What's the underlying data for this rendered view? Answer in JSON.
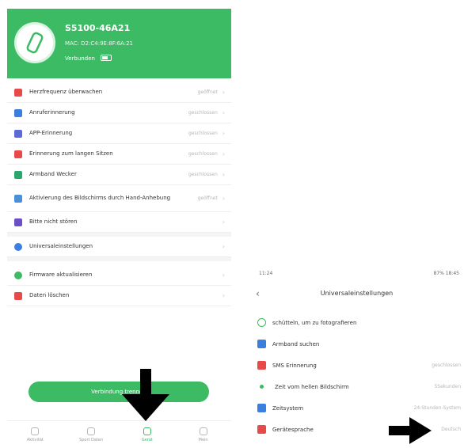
{
  "left": {
    "device": {
      "name": "S5100-46A21",
      "mac": "MAC: D2:C4:9E:8F:6A:21",
      "status": "Verbunden"
    },
    "rows": [
      {
        "label": "Herzfrequenz überwachen",
        "value": "geöffnet",
        "color": "#e84a4a",
        "icon": "heart-icon"
      },
      {
        "label": "Anruferinnerung",
        "value": "geschlossen",
        "color": "#3a7fe0",
        "icon": "phone-icon"
      },
      {
        "label": "APP-Erinnerung",
        "value": "geschlossen",
        "color": "#5a6bd8",
        "icon": "app-icon"
      },
      {
        "label": "Erinnerung zum langen Sitzen",
        "value": "geschlossen",
        "color": "#e84a4a",
        "icon": "sofa-icon"
      },
      {
        "label": "Armband Wecker",
        "value": "geschlossen",
        "color": "#2aa86c",
        "icon": "alarm-icon"
      },
      {
        "label": "Aktivierung des Bildschirms durch Hand-Anhebung",
        "value": "geöffnet",
        "color": "#4a90d9",
        "icon": "hand-icon"
      },
      {
        "label": "Bitte nicht stören",
        "value": "",
        "color": "#6a4fc8",
        "icon": "moon-icon"
      },
      {
        "label": "Universaleinstellungen",
        "value": "",
        "color": "#3a7fe0",
        "icon": "settings-icon"
      },
      {
        "label": "Firmware aktualisieren",
        "value": "",
        "color": "#3dbb64",
        "icon": "update-icon"
      },
      {
        "label": "Daten löschen",
        "value": "",
        "color": "#e84a4a",
        "icon": "trash-icon"
      }
    ],
    "connect_button": "Verbindung trennen",
    "tabs": [
      "Aktivität",
      "Sport Daten",
      "Gerät",
      "Mein"
    ]
  },
  "right": {
    "status_time": "11:24",
    "status_right": "87% 18:45",
    "title": "Universaleinstellungen",
    "rows": [
      {
        "label": "schütteln, um zu fotografieren",
        "value": "",
        "color": "#3dbb64",
        "icon": "camera-icon"
      },
      {
        "label": "Armband suchen",
        "value": "",
        "color": "#3a7fe0",
        "icon": "search-icon"
      },
      {
        "label": "SMS Erinnerung",
        "value": "geschlossen",
        "color": "#e84a4a",
        "icon": "sms-icon"
      },
      {
        "label": "Zeit vom hellen Bildschirm",
        "value": "5Sekunden",
        "color": "#3dbb64",
        "icon": "clock-icon"
      },
      {
        "label": "Zeitsystem",
        "value": "24-Stunden-System",
        "color": "#3a7fe0",
        "icon": "time-icon"
      },
      {
        "label": "Geräte­sprache",
        "value": "Deutsch",
        "color": "#e84a4a",
        "icon": "language-icon"
      }
    ]
  },
  "colors": {
    "accent": "#3dbb64"
  }
}
